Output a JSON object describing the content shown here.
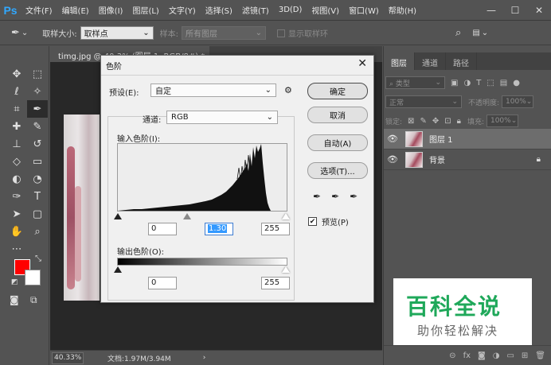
{
  "app": {
    "logo": "Ps"
  },
  "menu": [
    "文件(F)",
    "编辑(E)",
    "图像(I)",
    "图层(L)",
    "文字(Y)",
    "选择(S)",
    "滤镜(T)",
    "3D(D)",
    "视图(V)",
    "窗口(W)",
    "帮助(H)"
  ],
  "window_controls": {
    "minimize": "—",
    "maximize": "☐",
    "close": "✕"
  },
  "options": {
    "sample_size_label": "取样大小:",
    "sample_size_value": "取样点",
    "sample_label": "样本:",
    "sample_value": "所有图层",
    "show_ring_label": "显示取样环"
  },
  "document": {
    "tab_title": "timg.jpg @ 40.3% (图层 1, RGB/8#) *",
    "zoom": "40.33%",
    "doc_info": "文档:1.97M/3.94M"
  },
  "layers_panel": {
    "tabs": [
      "图层",
      "通道",
      "路径"
    ],
    "filter_kind": "类型",
    "blend_mode": "正常",
    "opacity_label": "不透明度:",
    "opacity_value": "100%",
    "lock_label": "锁定:",
    "fill_label": "填充:",
    "fill_value": "100%",
    "layers": [
      {
        "name": "图层 1",
        "selected": true
      },
      {
        "name": "背景",
        "selected": false,
        "locked": true
      }
    ]
  },
  "levels_dialog": {
    "title": "色阶",
    "preset_label": "预设(E):",
    "preset_value": "自定",
    "channel_label": "通道:",
    "channel_value": "RGB",
    "input_levels_label": "输入色阶(I):",
    "input_black": "0",
    "input_gamma": "1.30",
    "input_white": "255",
    "output_levels_label": "输出色阶(O):",
    "output_black": "0",
    "output_white": "255",
    "buttons": {
      "ok": "确定",
      "cancel": "取消",
      "auto": "自动(A)",
      "options": "选项(T)..."
    },
    "preview_label": "预览(P)",
    "preview_checked": true
  },
  "watermark": {
    "title": "百科全说",
    "subtitle": "助你轻松解决"
  },
  "colors": {
    "foreground": "#ff0000",
    "background": "#ffffff",
    "watermark_green": "#1fa85a",
    "accent": "#31a8ff"
  }
}
